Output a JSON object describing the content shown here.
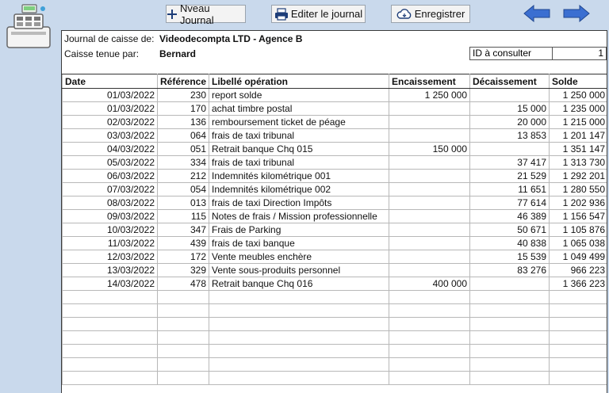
{
  "toolbar": {
    "new_journal_label": "Nveau Journal",
    "edit_journal_label": "Editer le journal",
    "save_label": "Enregistrer"
  },
  "header": {
    "journal_label": "Journal de caisse de:",
    "journal_value": "Videodecompta LTD - Agence B",
    "keeper_label": "Caisse tenue par:",
    "keeper_value": "Bernard",
    "id_label": "ID à consulter",
    "id_value": "1"
  },
  "table": {
    "columns": [
      "Date",
      "Référence",
      "Libellé opération",
      "Encaissement",
      "Décaissement",
      "Solde"
    ],
    "rows": [
      [
        "01/03/2022",
        "230",
        "report solde",
        "1 250 000",
        "",
        "1 250 000"
      ],
      [
        "01/03/2022",
        "170",
        "achat timbre postal",
        "",
        "15 000",
        "1 235 000"
      ],
      [
        "02/03/2022",
        "136",
        "remboursement ticket de péage",
        "",
        "20 000",
        "1 215 000"
      ],
      [
        "03/03/2022",
        "064",
        "frais de taxi tribunal",
        "",
        "13 853",
        "1 201 147"
      ],
      [
        "04/03/2022",
        "051",
        "Retrait banque Chq 015",
        "150 000",
        "",
        "1 351 147"
      ],
      [
        "05/03/2022",
        "334",
        "frais de taxi tribunal",
        "",
        "37 417",
        "1 313 730"
      ],
      [
        "06/03/2022",
        "212",
        "Indemnités kilométrique 001",
        "",
        "21 529",
        "1 292 201"
      ],
      [
        "07/03/2022",
        "054",
        "Indemnités kilométrique 002",
        "",
        "11 651",
        "1 280 550"
      ],
      [
        "08/03/2022",
        "013",
        "frais de taxi Direction Impôts",
        "",
        "77 614",
        "1 202 936"
      ],
      [
        "09/03/2022",
        "115",
        "Notes de frais / Mission professionnelle",
        "",
        "46 389",
        "1 156 547"
      ],
      [
        "10/03/2022",
        "347",
        "Frais de Parking",
        "",
        "50 671",
        "1 105 876"
      ],
      [
        "11/03/2022",
        "439",
        "frais de taxi banque",
        "",
        "40 838",
        "1 065 038"
      ],
      [
        "12/03/2022",
        "172",
        "Vente meubles enchère",
        "",
        "15 539",
        "1 049 499"
      ],
      [
        "13/03/2022",
        "329",
        "Vente sous-produits personnel",
        "",
        "83 276",
        "966 223"
      ],
      [
        "14/03/2022",
        "478",
        "Retrait banque Chq 016",
        "400 000",
        "",
        "1 366 223"
      ],
      [
        "",
        "",
        "",
        "",
        "",
        ""
      ],
      [
        "",
        "",
        "",
        "",
        "",
        ""
      ],
      [
        "",
        "",
        "",
        "",
        "",
        ""
      ],
      [
        "",
        "",
        "",
        "",
        "",
        ""
      ],
      [
        "",
        "",
        "",
        "",
        "",
        ""
      ],
      [
        "",
        "",
        "",
        "",
        "",
        ""
      ],
      [
        "",
        "",
        "",
        "",
        "",
        ""
      ]
    ]
  },
  "icons": {
    "register": "cash-register-icon",
    "new": "plus-icon",
    "edit": "printer-icon",
    "save": "cloud-save-icon",
    "prev": "arrow-left-icon",
    "next": "arrow-right-icon"
  },
  "colors": {
    "background": "#c9d9ec",
    "arrow": "#3b6fd1"
  }
}
